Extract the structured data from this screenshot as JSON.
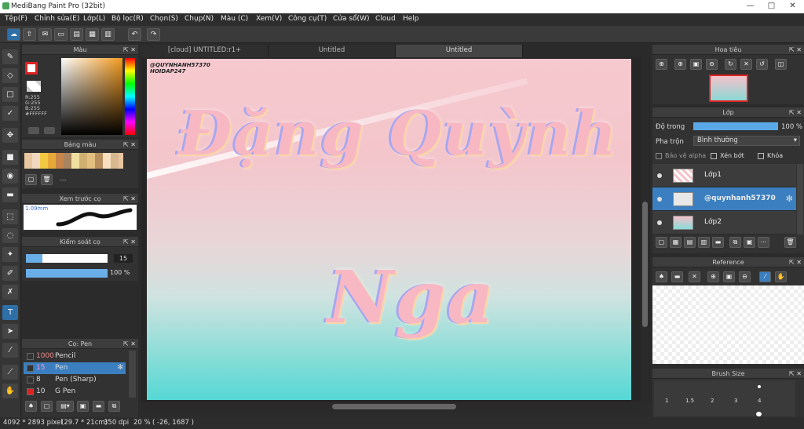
{
  "window": {
    "title": "MediBang Paint Pro (32bit)"
  },
  "menu": [
    "Tệp(F)",
    "Chỉnh sửa(E)",
    "Lớp(L)",
    "Bộ lọc(R)",
    "Chọn(S)",
    "Chụp(N)",
    "Màu (C)",
    "Xem(V)",
    "Công cụ(T)",
    "Cửa sổ(W)",
    "Cloud",
    "Help"
  ],
  "tabs": [
    "[cloud] UNTITLED:r1+",
    "Untitled",
    "Untitled"
  ],
  "color_panel": {
    "title": "Màu",
    "rgb": [
      "R:255",
      "G:255",
      "B:255"
    ],
    "hex": "#FFFFFF"
  },
  "palette_panel": {
    "title": "Bảng màu",
    "placeholder": "---"
  },
  "brush_preview": {
    "title": "Xem trước cọ",
    "size": "1.09mm"
  },
  "brush_control": {
    "title": "Kiểm soát cọ",
    "size": "15",
    "opacity": "100 %",
    "size_level": 0.2,
    "opacity_level": 1.0
  },
  "brush_list": {
    "title": "Cọ: Pen",
    "items": [
      {
        "size": "1000",
        "name": "Pencil"
      },
      {
        "size": "15",
        "name": "Pen"
      },
      {
        "size": "8",
        "name": "Pen (Sharp)"
      },
      {
        "size": "10",
        "name": "G Pen"
      }
    ]
  },
  "canvas": {
    "watermark": [
      "@QUYNHANH57370",
      "HOIDAP247"
    ],
    "line1": "Đặng Quỳnh",
    "line2": "Nga"
  },
  "navigator": {
    "title": "Hoa tiêu"
  },
  "layers_panel": {
    "title": "Lớp",
    "opacity_label": "Độ trong",
    "opacity_value": "100 %",
    "blend_label": "Pha trộn",
    "blend_value": "Bình thường",
    "protect_alpha": "Bảo vệ alpha",
    "clipping": "Xén bớt",
    "lock": "Khóa",
    "layers": [
      "Lớp1",
      "@quynhanh57370",
      "Lớp2"
    ]
  },
  "reference": {
    "title": "Reference"
  },
  "brush_size": {
    "title": "Brush Size",
    "values": [
      "1",
      "1.5",
      "2",
      "3",
      "4"
    ]
  },
  "status": {
    "dimensions": "4092 * 2893 pixel",
    "size_cm": "(29.7 * 21cm)",
    "dpi": "350 dpi",
    "zoom": "20 %",
    "coords": "( -26, 1687 )"
  },
  "colors": {
    "accent": "#3b7fc0",
    "text_pink": "#f7b8c4",
    "outline_purple": "#a7a7f0"
  }
}
